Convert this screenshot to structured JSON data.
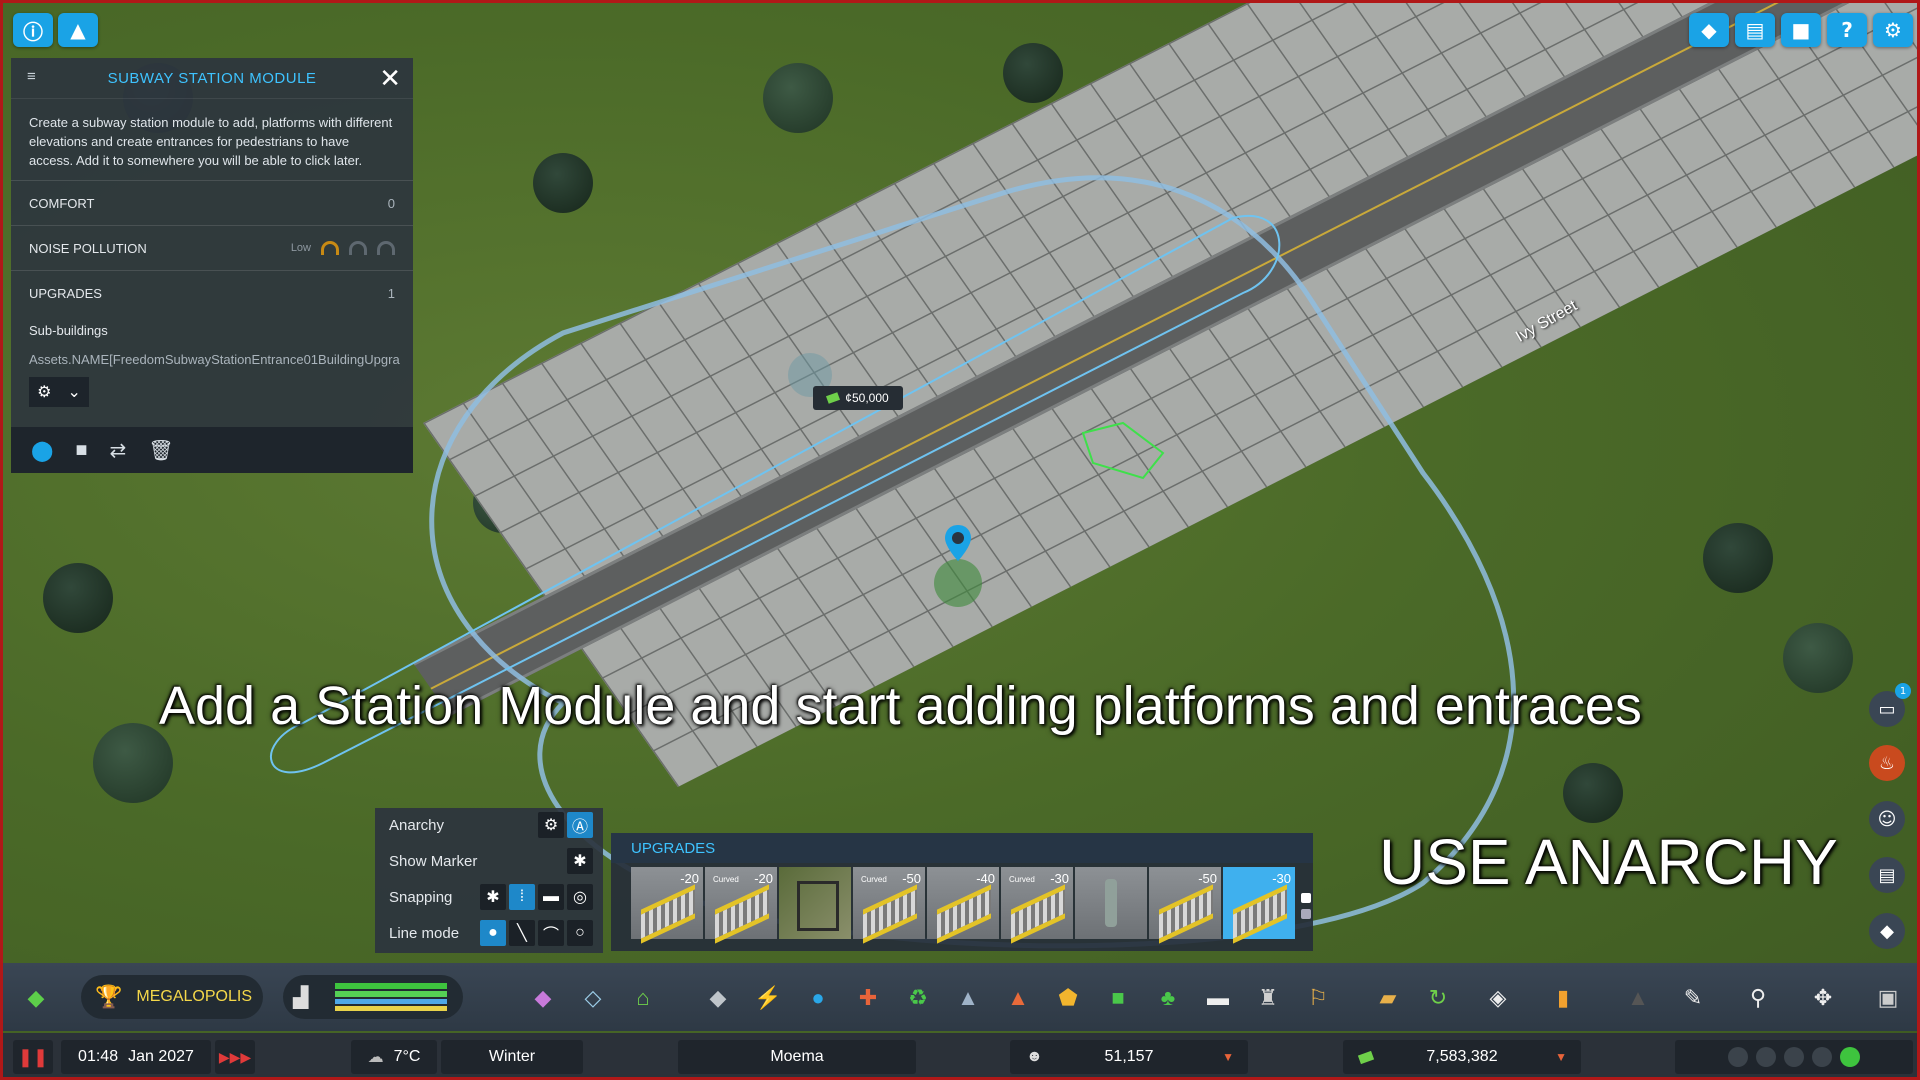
{
  "top_left_buttons": [
    {
      "icon": "info-icon"
    },
    {
      "icon": "cone-icon"
    }
  ],
  "top_right_buttons": [
    {
      "icon": "diamond-icon"
    },
    {
      "icon": "book-icon"
    },
    {
      "icon": "camera-icon"
    },
    {
      "icon": "help-icon"
    },
    {
      "icon": "gear-icon"
    }
  ],
  "panel": {
    "title": "SUBWAY STATION MODULE",
    "description": "Create a subway station module to add, platforms with different elevations and create entrances for pedestrians to have access. Add it to somewhere you will be able to click later.",
    "comfort_label": "COMFORT",
    "comfort_value": "0",
    "noise_label": "NOISE POLLUTION",
    "noise_level": "Low",
    "upgrades_label": "UPGRADES",
    "upgrades_value": "1",
    "sub_buildings_label": "Sub-buildings",
    "asset_name": "Assets.NAME[FreedomSubwayStationEntrance01BuildingUpgra"
  },
  "map": {
    "price_tag": "¢50,000",
    "street_name": "Ivy Street"
  },
  "anarchy_panel": {
    "anarchy_label": "Anarchy",
    "show_marker_label": "Show Marker",
    "snapping_label": "Snapping",
    "line_mode_label": "Line mode"
  },
  "upgrades_bar": {
    "title": "UPGRADES",
    "items": [
      {
        "tag": "",
        "cost": "-20",
        "kind": "track"
      },
      {
        "tag": "Curved",
        "cost": "-20",
        "kind": "track"
      },
      {
        "tag": "",
        "cost": "",
        "kind": "photo"
      },
      {
        "tag": "Curved",
        "cost": "-50",
        "kind": "track"
      },
      {
        "tag": "",
        "cost": "-40",
        "kind": "track"
      },
      {
        "tag": "Curved",
        "cost": "-30",
        "kind": "track"
      },
      {
        "tag": "",
        "cost": "",
        "kind": "statue"
      },
      {
        "tag": "",
        "cost": "-50",
        "kind": "track"
      },
      {
        "tag": "",
        "cost": "-30",
        "kind": "track",
        "selected": true
      }
    ]
  },
  "captions": {
    "main": "Add a Station Module and start adding platforms and entraces",
    "anarchy": "USE ANARCHY"
  },
  "toolbar": {
    "milestone": "MEGALOPOLIS"
  },
  "status": {
    "time": "01:48",
    "date": "Jan 2027",
    "temperature": "7°C",
    "season": "Winter",
    "city_name": "Moema",
    "population": "51,157",
    "money": "7,583,382"
  },
  "side_badge": "1",
  "colors": {
    "accent": "#3ec3ff",
    "panel_bg": "#2c343e",
    "border": "#b01818"
  }
}
